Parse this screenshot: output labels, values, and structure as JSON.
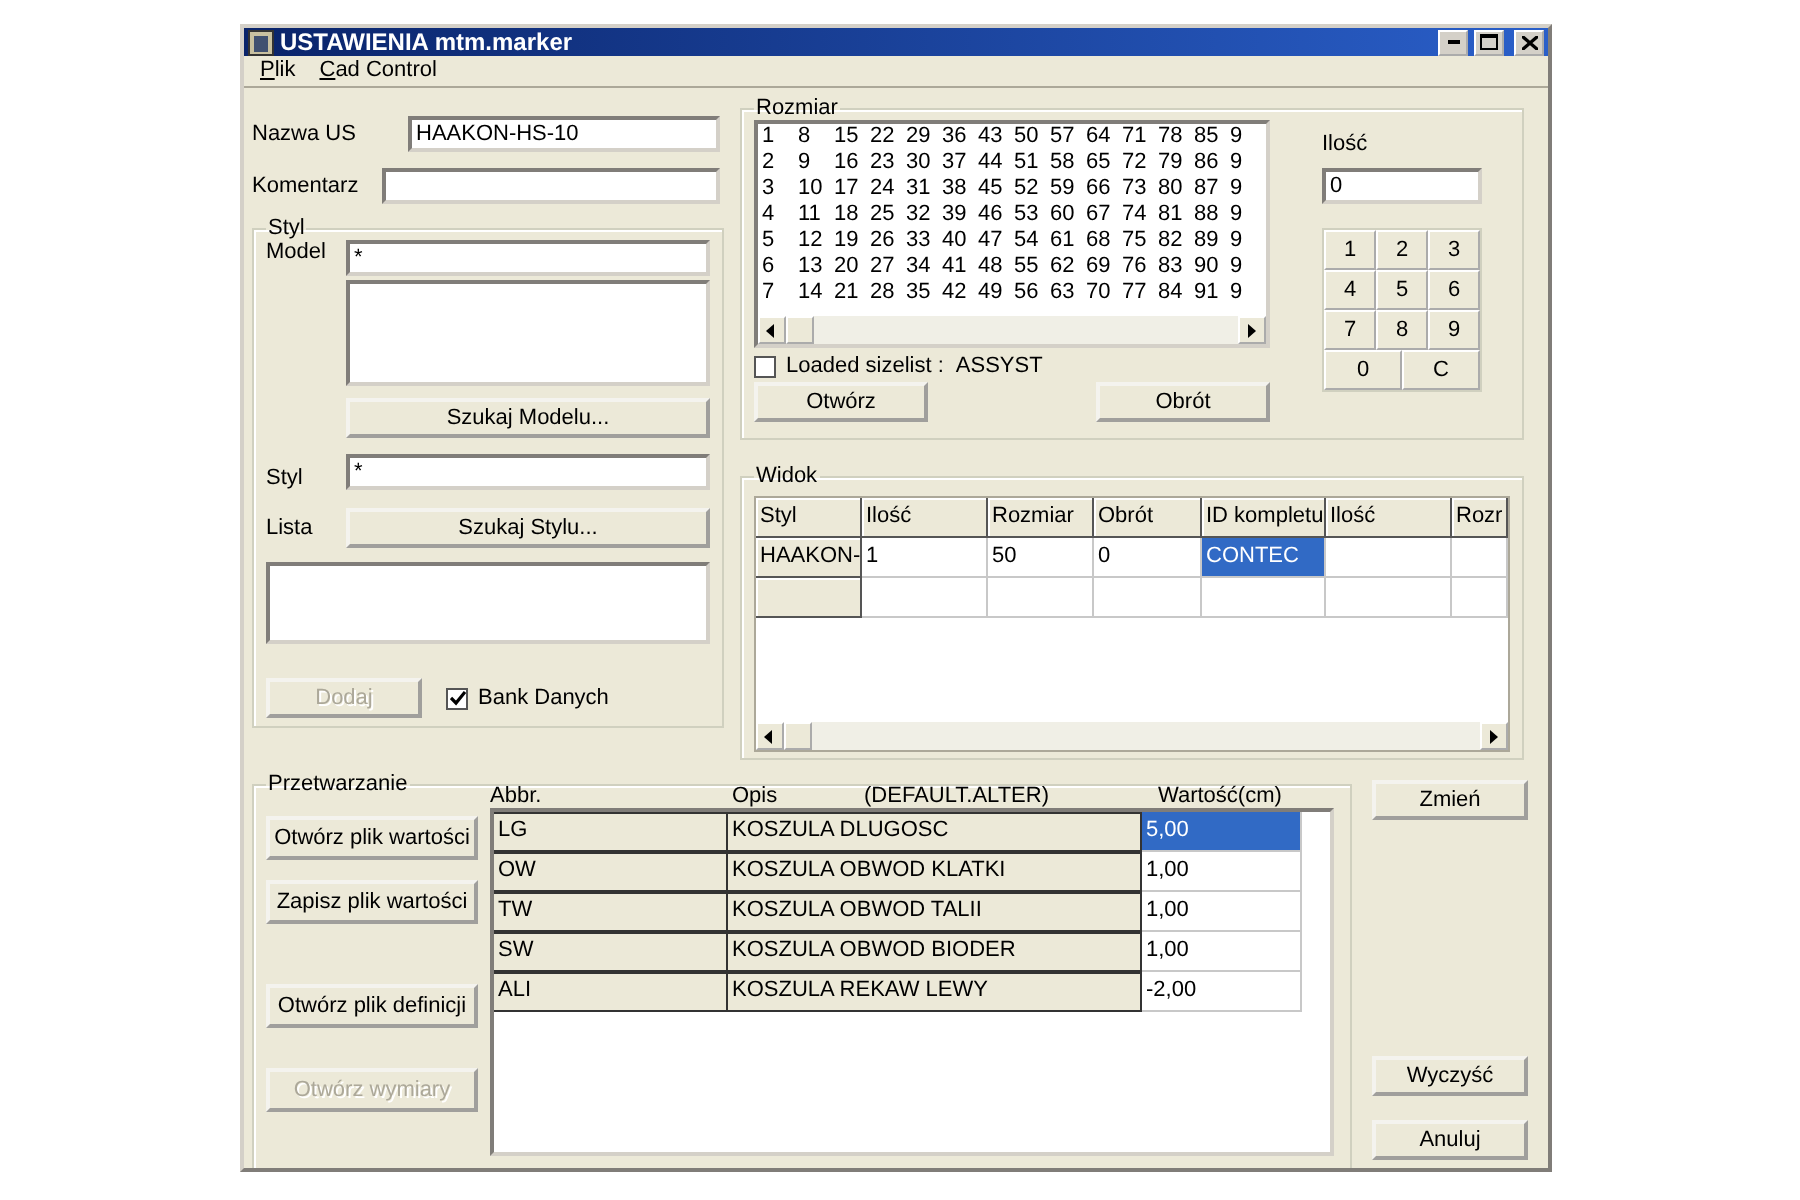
{
  "window": {
    "title": "USTAWIENIA mtm.marker"
  },
  "menu": [
    {
      "label": "Plik"
    },
    {
      "label": "Cad Control"
    }
  ],
  "nazwa": {
    "label": "Nazwa US",
    "value": "HAAKON-HS-10"
  },
  "komentarz": {
    "label": "Komentarz"
  },
  "styl_group": {
    "title": "Styl",
    "model_label": "Model",
    "model_value": "*",
    "model_button": "Szukaj Modelu...",
    "styl_label": "Styl",
    "styl_value": "*",
    "lista_label": "Lista",
    "styl_button": "Szukaj Stylu...",
    "add_button": {
      "label": "Dodaj",
      "disabled": true
    },
    "bank": {
      "label": "Bank Danych",
      "checked": true
    }
  },
  "rozmiar": {
    "title": "Rozmiar",
    "sizes": [
      [
        "1",
        "8",
        "15",
        "22",
        "29",
        "36",
        "43",
        "50",
        "57",
        "64",
        "71",
        "78",
        "85",
        "9"
      ],
      [
        "2",
        "9",
        "16",
        "23",
        "30",
        "37",
        "44",
        "51",
        "58",
        "65",
        "72",
        "79",
        "86",
        "9"
      ],
      [
        "3",
        "10",
        "17",
        "24",
        "31",
        "38",
        "45",
        "52",
        "59",
        "66",
        "73",
        "80",
        "87",
        "9"
      ],
      [
        "4",
        "11",
        "18",
        "25",
        "32",
        "39",
        "46",
        "53",
        "60",
        "67",
        "74",
        "81",
        "88",
        "9"
      ],
      [
        "5",
        "12",
        "19",
        "26",
        "33",
        "40",
        "47",
        "54",
        "61",
        "68",
        "75",
        "82",
        "89",
        "9"
      ],
      [
        "6",
        "13",
        "20",
        "27",
        "34",
        "41",
        "48",
        "55",
        "62",
        "69",
        "76",
        "83",
        "90",
        "9"
      ],
      [
        "7",
        "14",
        "21",
        "28",
        "35",
        "42",
        "49",
        "56",
        "63",
        "70",
        "77",
        "84",
        "91",
        "9"
      ]
    ],
    "loaded": {
      "label": "Loaded sizelist :",
      "checked": false,
      "value": "ASSYST"
    },
    "buttons": [
      "Otwórz",
      "Obrót"
    ],
    "ilosc_label": "Ilość",
    "ilosc_value": "0",
    "keys": [
      {
        "label": "1",
        "kind": "narrow"
      },
      {
        "label": "2",
        "kind": "narrow"
      },
      {
        "label": "3",
        "kind": "narrow"
      },
      {
        "label": "4",
        "kind": "narrow"
      },
      {
        "label": "5",
        "kind": "narrow"
      },
      {
        "label": "6",
        "kind": "narrow"
      },
      {
        "label": "7",
        "kind": "narrow"
      },
      {
        "label": "8",
        "kind": "narrow"
      },
      {
        "label": "9",
        "kind": "narrow"
      },
      {
        "label": "0",
        "kind": "wide"
      },
      {
        "label": "C",
        "kind": "wide"
      }
    ]
  },
  "widok": {
    "title": "Widok",
    "columns": [
      "Styl",
      "Ilość",
      "Rozmiar",
      "Obrót",
      "ID kompletu",
      "Ilość",
      "Rozr"
    ],
    "rows": [
      {
        "cells": [
          {
            "kind": "header",
            "text": "HAAKON-",
            "selected": false
          },
          {
            "kind": "data",
            "text": "1",
            "selected": false
          },
          {
            "kind": "data",
            "text": "50",
            "selected": false
          },
          {
            "kind": "data",
            "text": "0",
            "selected": false
          },
          {
            "kind": "data",
            "text": "CONTEC",
            "selected": true
          },
          {
            "kind": "data",
            "selected": false
          },
          {
            "kind": "data",
            "selected": false
          }
        ]
      },
      {
        "cells": [
          {
            "kind": "header",
            "selected": false
          },
          {
            "kind": "data",
            "selected": false
          },
          {
            "kind": "data",
            "selected": false
          },
          {
            "kind": "data",
            "selected": false
          },
          {
            "kind": "data",
            "selected": false
          },
          {
            "kind": "data",
            "selected": false
          },
          {
            "kind": "data",
            "selected": false
          }
        ]
      }
    ]
  },
  "przetwarzanie": {
    "title": "Przetwarzanie",
    "buttons": [
      {
        "label": "Otwórz plik wartości",
        "disabled": false
      },
      {
        "label": "Zapisz plik wartości",
        "disabled": false
      },
      {
        "label": "Otwórz plik definicji",
        "disabled": false
      },
      {
        "label": "Otwórz wymiary",
        "disabled": true
      }
    ],
    "headers": [
      "Abbr.",
      "Opis",
      "(DEFAULT.ALTER)",
      "Wartość(cm)"
    ],
    "rows": [
      {
        "abbr": "LG",
        "opis": "KOSZULA DLUGOSC",
        "value": "5,00",
        "selected": true
      },
      {
        "abbr": "OW",
        "opis": "KOSZULA OBWOD KLATKI",
        "value": "1,00",
        "selected": false
      },
      {
        "abbr": "TW",
        "opis": "KOSZULA OBWOD TALII",
        "value": "1,00",
        "selected": false
      },
      {
        "abbr": "SW",
        "opis": "KOSZULA OBWOD BIODER",
        "value": "1,00",
        "selected": false
      },
      {
        "abbr": "ALI",
        "opis": "KOSZULA REKAW LEWY",
        "value": "-2,00",
        "selected": false
      }
    ]
  },
  "side_buttons": [
    "Zmień",
    "Wyczyść",
    "Anuluj"
  ]
}
